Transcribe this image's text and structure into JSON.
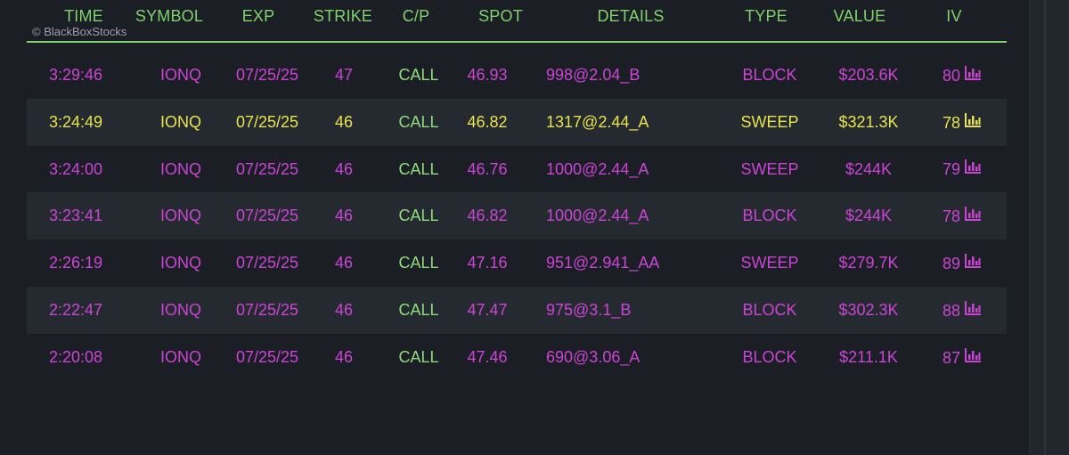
{
  "watermark": "© BlackBoxStocks",
  "colors": {
    "magenta": "#cc44d6",
    "yellow": "#e8e44a",
    "green": "#8fdc7a",
    "header": "#7fd36a"
  },
  "columns": [
    "TIME",
    "SYMBOL",
    "EXP",
    "STRIKE",
    "C/P",
    "SPOT",
    "DETAILS",
    "TYPE",
    "VALUE",
    "IV"
  ],
  "rows": [
    {
      "time": "3:29:46",
      "symbol": "IONQ",
      "exp": "07/25/25",
      "strike": "47",
      "cp": "CALL",
      "spot": "46.93",
      "details": "998@2.04_B",
      "type": "BLOCK",
      "value": "$203.6K",
      "iv": "80",
      "color": "#cc44d6"
    },
    {
      "time": "3:24:49",
      "symbol": "IONQ",
      "exp": "07/25/25",
      "strike": "46",
      "cp": "CALL",
      "spot": "46.82",
      "details": "1317@2.44_A",
      "type": "SWEEP",
      "value": "$321.3K",
      "iv": "78",
      "color": "#e8e44a"
    },
    {
      "time": "3:24:00",
      "symbol": "IONQ",
      "exp": "07/25/25",
      "strike": "46",
      "cp": "CALL",
      "spot": "46.76",
      "details": "1000@2.44_A",
      "type": "SWEEP",
      "value": "$244K",
      "iv": "79",
      "color": "#cc44d6"
    },
    {
      "time": "3:23:41",
      "symbol": "IONQ",
      "exp": "07/25/25",
      "strike": "46",
      "cp": "CALL",
      "spot": "46.82",
      "details": "1000@2.44_A",
      "type": "BLOCK",
      "value": "$244K",
      "iv": "78",
      "color": "#cc44d6"
    },
    {
      "time": "2:26:19",
      "symbol": "IONQ",
      "exp": "07/25/25",
      "strike": "46",
      "cp": "CALL",
      "spot": "47.16",
      "details": "951@2.941_AA",
      "type": "SWEEP",
      "value": "$279.7K",
      "iv": "89",
      "color": "#cc44d6"
    },
    {
      "time": "2:22:47",
      "symbol": "IONQ",
      "exp": "07/25/25",
      "strike": "46",
      "cp": "CALL",
      "spot": "47.47",
      "details": "975@3.1_B",
      "type": "BLOCK",
      "value": "$302.3K",
      "iv": "88",
      "color": "#cc44d6"
    },
    {
      "time": "2:20:08",
      "symbol": "IONQ",
      "exp": "07/25/25",
      "strike": "46",
      "cp": "CALL",
      "spot": "47.46",
      "details": "690@3.06_A",
      "type": "BLOCK",
      "value": "$211.1K",
      "iv": "87",
      "color": "#cc44d6"
    }
  ]
}
